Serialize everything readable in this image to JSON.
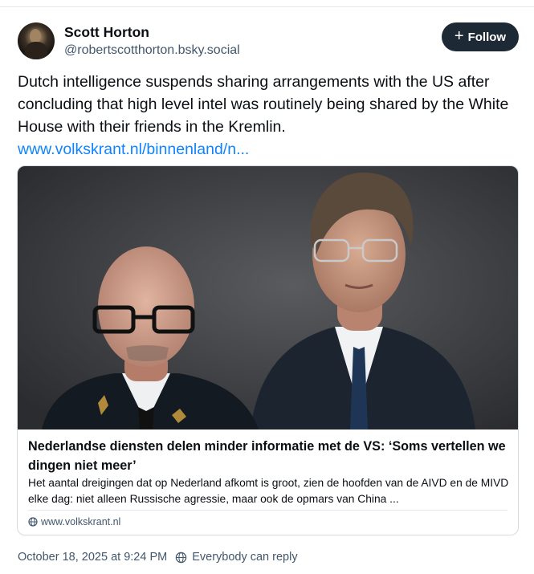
{
  "post": {
    "author": {
      "display_name": "Scott Horton",
      "handle": "@robertscotthorton.bsky.social",
      "avatar_icon": "portrait-avatar"
    },
    "follow_label": "Follow",
    "text": "Dutch intelligence suspends sharing arrangements with the US after concluding that high level intel was routinely being shared by the White House with their friends in the Kremlin.",
    "link_text": "www.volkskrant.nl/binnenland/n...",
    "timestamp": "October 18, 2025 at 9:24 PM",
    "reply_setting": "Everybody can reply"
  },
  "card": {
    "title": "Nederlandse diensten delen minder informatie met de VS: ‘Soms vertellen we dingen niet meer’",
    "description": "Het aantal dreigingen dat op Nederland afkomt is groot, zien de hoofden van de AIVD en de MIVD elke dag: niet alleen Russische agressie, maar ook de opmars van China ...",
    "domain": "www.volkskrant.nl",
    "image_alt_icon": "two-men-portrait-photo"
  },
  "colors": {
    "link": "#1083fe",
    "button_bg": "#1e2936",
    "muted_text": "#42576c",
    "border": "#d4dbe2"
  }
}
